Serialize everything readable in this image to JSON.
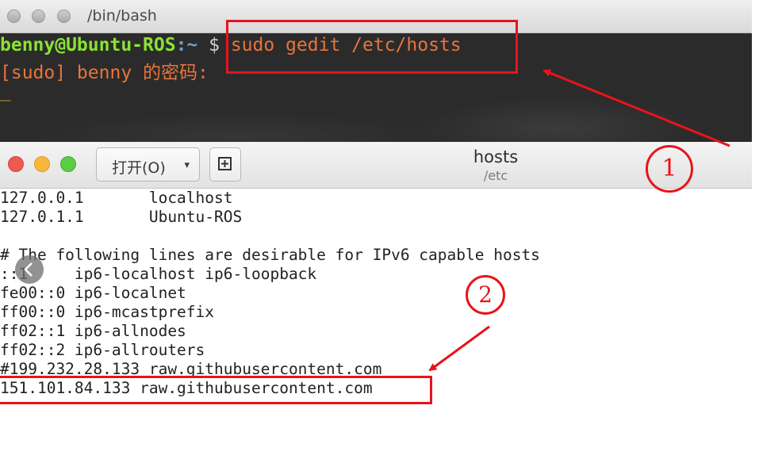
{
  "terminal": {
    "title": "/bin/bash",
    "prompt_user": "benny@Ubuntu-ROS",
    "prompt_path": ":~",
    "prompt_symbol": " $",
    "command": " sudo gedit /etc/hosts",
    "sudo_prompt": "[sudo] benny 的密码:",
    "cursor": "_"
  },
  "gedit": {
    "open_button": "打开(O)",
    "open_caret": "▾",
    "doc_title": "hosts",
    "doc_path": "/etc",
    "lines": [
      "127.0.0.1       localhost",
      "127.0.1.1       Ubuntu-ROS",
      "",
      "# The following lines are desirable for IPv6 capable hosts",
      "::1     ip6-localhost ip6-loopback",
      "fe00::0 ip6-localnet",
      "ff00::0 ip6-mcastprefix",
      "ff02::1 ip6-allnodes",
      "ff02::2 ip6-allrouters",
      "#199.232.28.133 raw.githubusercontent.com",
      "151.101.84.133 raw.githubusercontent.com"
    ]
  },
  "annotations": {
    "label_1": "1",
    "label_2": "2",
    "color": "#e8141b"
  },
  "icons": [
    "window-close-icon",
    "window-minimize-icon",
    "window-maximize-icon",
    "new-document-icon",
    "chevron-left-icon"
  ]
}
